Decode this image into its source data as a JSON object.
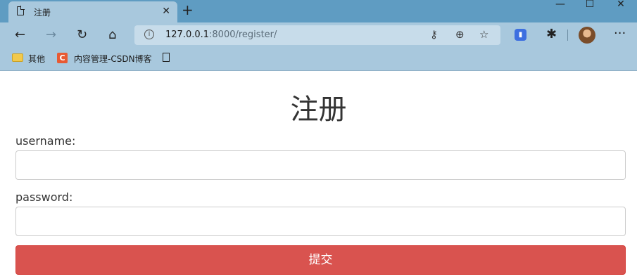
{
  "browser": {
    "tab_title": "注册",
    "tab_close": "✕",
    "new_tab": "+",
    "url_host": "127.0.0.1",
    "url_rest": ":8000/register/",
    "window_controls": {
      "minimize": "—",
      "maximize": "☐",
      "close": "✕"
    },
    "nav_icons": [
      "back-arrow-icon",
      "forward-arrow-icon",
      "refresh-icon",
      "home-icon"
    ],
    "more_menu": "···",
    "bookmarks": [
      {
        "label": "其他",
        "icon": "folder-icon"
      },
      {
        "label": "内容管理-CSDN博客",
        "icon": "csdn-icon",
        "icon_text": "C"
      },
      {
        "label": "",
        "icon": "document-icon"
      }
    ]
  },
  "page": {
    "title": "注册",
    "username_label": "username:",
    "username_value": "",
    "password_label": "password:",
    "password_value": "",
    "submit_label": "提交"
  },
  "colors": {
    "titlebar": "#5f9cc2",
    "toolbar": "#a8c8dd",
    "submit_bg": "#d9534f"
  }
}
